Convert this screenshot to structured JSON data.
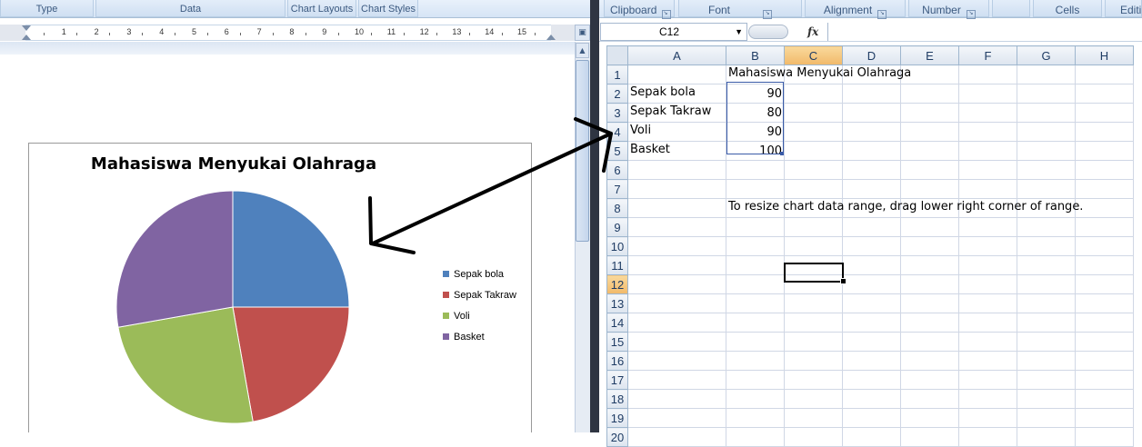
{
  "word": {
    "ribbon_groups": [
      "Type",
      "Data",
      "Chart Layouts",
      "Chart Styles"
    ],
    "ruler_numbers": [
      "1",
      "1",
      "2",
      "3",
      "4",
      "5",
      "6",
      "7",
      "8",
      "9",
      "10",
      "11",
      "12",
      "13",
      "14",
      "15"
    ],
    "chart": {
      "title": "Mahasiswa Menyukai Olahraga",
      "legend": [
        "Sepak bola",
        "Sepak Takraw",
        "Voli",
        "Basket"
      ]
    }
  },
  "excel": {
    "ribbon_groups": [
      "Clipboard",
      "Font",
      "Alignment",
      "Number",
      "Cells",
      "Editi"
    ],
    "name_box": "C12",
    "fx_label": "fx",
    "formula": "",
    "columns": [
      "A",
      "B",
      "C",
      "D",
      "E",
      "F",
      "G",
      "H"
    ],
    "rows": [
      "1",
      "2",
      "3",
      "4",
      "5",
      "6",
      "7",
      "8",
      "9",
      "10",
      "11",
      "12",
      "13",
      "14",
      "15",
      "16",
      "17",
      "18",
      "19",
      "20"
    ],
    "selected_column": "C",
    "selected_row": "12",
    "cells": {
      "B1": "Mahasiswa Menyukai Olahraga",
      "A2": "Sepak bola",
      "B2": "90",
      "A3": "Sepak Takraw",
      "B3": "80",
      "A4": "Voli",
      "B4": "90",
      "A5": "Basket",
      "B5": "100",
      "B8": "To resize chart data range, drag lower right corner of range."
    }
  },
  "chart_data": {
    "type": "pie",
    "title": "Mahasiswa Menyukai Olahraga",
    "categories": [
      "Sepak bola",
      "Sepak Takraw",
      "Voli",
      "Basket"
    ],
    "values": [
      90,
      80,
      90,
      100
    ],
    "colors": [
      "#4f81bd",
      "#c0504d",
      "#9bbb59",
      "#8064a2"
    ],
    "legend_position": "right"
  }
}
